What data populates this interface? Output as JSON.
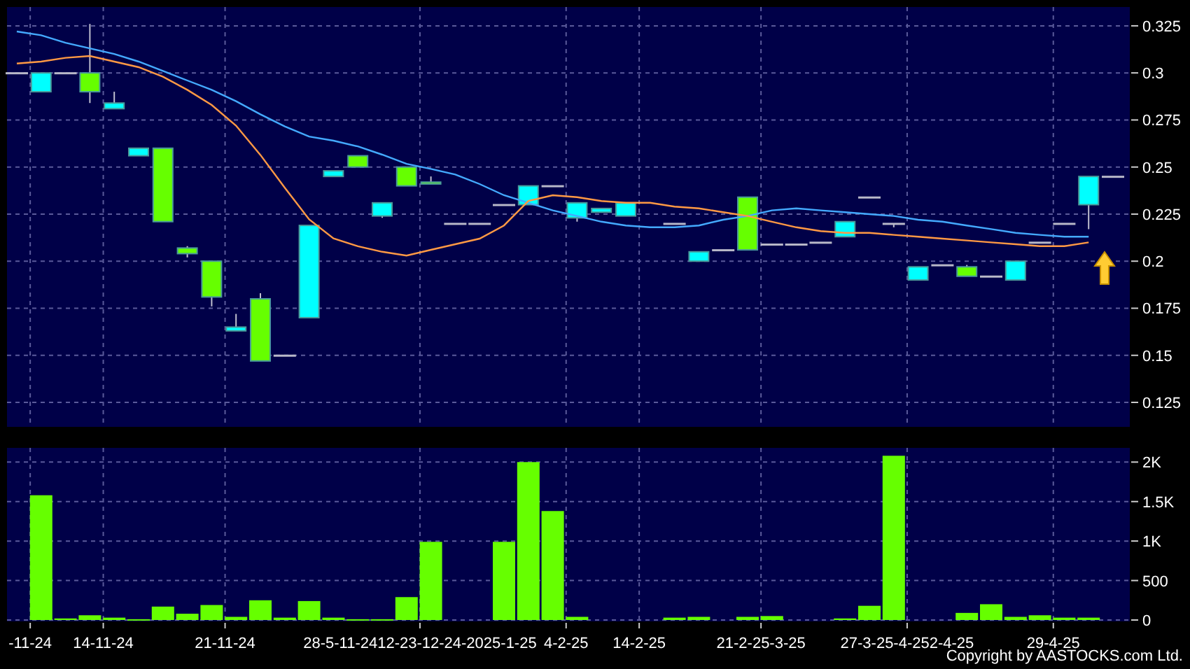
{
  "price_chart": {
    "chart_data": {
      "type": "line",
      "grid": true,
      "ylim": [
        0.112,
        0.335
      ],
      "yticks": [
        0.125,
        0.15,
        0.175,
        0.2,
        0.225,
        0.25,
        0.275,
        0.3,
        0.325
      ],
      "series": [
        {
          "color": "#44aaff",
          "values": [
            0.322,
            0.32,
            0.316,
            0.313,
            0.31,
            0.306,
            0.301,
            0.296,
            0.291,
            0.285,
            0.278,
            0.2716,
            0.2662,
            0.264,
            0.261,
            0.2566,
            0.2517,
            0.249,
            0.246,
            0.241,
            0.235,
            0.231,
            0.227,
            0.224,
            0.221,
            0.219,
            0.218,
            0.218,
            0.219,
            0.222,
            0.224,
            0.227,
            0.228,
            0.227,
            0.226,
            0.225,
            0.224,
            0.222,
            0.221,
            0.219,
            0.217,
            0.215,
            0.214,
            0.213,
            0.213,
            null
          ]
        },
        {
          "color": "#ff9944",
          "values": [
            0.305,
            0.306,
            0.308,
            0.309,
            0.306,
            0.303,
            0.298,
            0.291,
            0.283,
            0.272,
            0.2564,
            0.239,
            0.2222,
            0.2121,
            0.208,
            0.205,
            0.203,
            0.206,
            0.209,
            0.212,
            0.219,
            0.232,
            0.235,
            0.234,
            0.232,
            0.231,
            0.231,
            0.229,
            0.228,
            0.226,
            0.224,
            0.221,
            0.218,
            0.216,
            0.215,
            0.215,
            0.214,
            0.213,
            0.212,
            0.211,
            0.21,
            0.209,
            0.208,
            0.208,
            0.21,
            null
          ]
        }
      ]
    }
  },
  "volume_chart": {
    "chart_data": {
      "type": "bar",
      "grid": true,
      "ylim": [
        0,
        2180
      ],
      "yticks": [
        0,
        500,
        {
          "value": 1000,
          "label": "1K"
        },
        {
          "value": 1500,
          "label": "1.5K"
        },
        {
          "value": 2000,
          "label": "2K"
        }
      ],
      "categories": [
        null,
        "-11-24",
        null,
        null,
        "14-11-24",
        null,
        null,
        null,
        null,
        "21-11-24",
        null,
        null,
        null,
        null,
        null,
        null,
        null,
        "28-5-11-2412-23-12-24-2025-1-25",
        null,
        null,
        null,
        null,
        null,
        "4-2-25",
        null,
        null,
        "14-2-25",
        null,
        null,
        null,
        null,
        "21-2-25-3-25",
        null,
        null,
        null,
        null,
        null,
        "27-3-25-4-252-4-25",
        null,
        null,
        null,
        null,
        null,
        "29-4-25",
        null,
        null
      ],
      "series": [
        {
          "color": "#66ff00",
          "values": [
            0,
            1580,
            20,
            60,
            30,
            10,
            170,
            80,
            190,
            40,
            250,
            30,
            240,
            30,
            10,
            10,
            290,
            990,
            0,
            0,
            990,
            2000,
            1380,
            40,
            0,
            0,
            0,
            30,
            40,
            0,
            40,
            50,
            0,
            0,
            20,
            180,
            2080,
            0,
            0,
            90,
            200,
            40,
            60,
            30,
            30,
            0
          ]
        }
      ]
    }
  },
  "copyright": "Copyright by AASTOCKS.com Ltd."
}
